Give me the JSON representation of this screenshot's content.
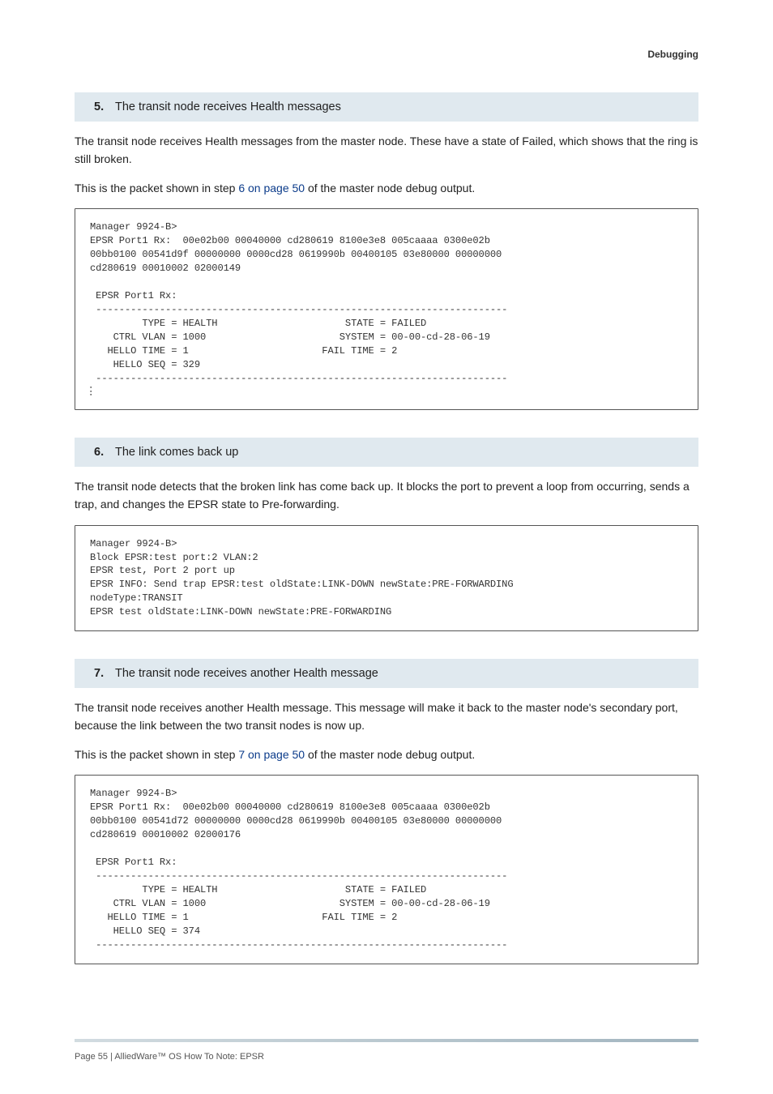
{
  "running_head": "Debugging",
  "steps": {
    "s5": {
      "num": "5.",
      "title": "The transit node receives Health messages"
    },
    "s6": {
      "num": "6.",
      "title": "The link comes back up"
    },
    "s7": {
      "num": "7.",
      "title": "The transit node receives another Health message"
    }
  },
  "paras": {
    "p5a": "The transit node receives Health messages from the master node. These have a state of Failed, which shows that the ring is still broken.",
    "p5b_prefix": "This is the packet shown in step ",
    "p5b_ref": "6 on page 50",
    "p5b_suffix": " of the master node debug output.",
    "p6a": "The transit node detects that the broken link has come back up. It blocks the port to prevent a loop from occurring, sends a trap, and changes the EPSR state to Pre-forwarding.",
    "p7a": "The transit node receives another Health message. This message will make it back to the master node's secondary port, because the link between the two transit nodes is now up.",
    "p7b_prefix": "This is the packet shown in step ",
    "p7b_ref": "7 on page 50",
    "p7b_suffix": " of the master node debug output."
  },
  "code": {
    "c5": "Manager 9924-B>\nEPSR Port1 Rx:  00e02b00 00040000 cd280619 8100e3e8 005caaaa 0300e02b\n00bb0100 00541d9f 00000000 0000cd28 0619990b 00400105 03e80000 00000000\ncd280619 00010002 02000149\n\n EPSR Port1 Rx:\n -----------------------------------------------------------------------\n         TYPE = HEALTH                      STATE = FAILED\n    CTRL VLAN = 1000                       SYSTEM = 00-00-cd-28-06-19\n   HELLO TIME = 1                       FAIL TIME = 2\n    HELLO SEQ = 329\n -----------------------------------------------------------------------",
    "c6": "Manager 9924-B>\nBlock EPSR:test port:2 VLAN:2\nEPSR test, Port 2 port up\nEPSR INFO: Send trap EPSR:test oldState:LINK-DOWN newState:PRE-FORWARDING\nnodeType:TRANSIT\nEPSR test oldState:LINK-DOWN newState:PRE-FORWARDING",
    "c7": "Manager 9924-B>\nEPSR Port1 Rx:  00e02b00 00040000 cd280619 8100e3e8 005caaaa 0300e02b\n00bb0100 00541d72 00000000 0000cd28 0619990b 00400105 03e80000 00000000\ncd280619 00010002 02000176\n\n EPSR Port1 Rx:\n -----------------------------------------------------------------------\n         TYPE = HEALTH                      STATE = FAILED\n    CTRL VLAN = 1000                       SYSTEM = 00-00-cd-28-06-19\n   HELLO TIME = 1                       FAIL TIME = 2\n    HELLO SEQ = 374\n -----------------------------------------------------------------------"
  },
  "footer": "Page 55 | AlliedWare™ OS How To Note: EPSR"
}
